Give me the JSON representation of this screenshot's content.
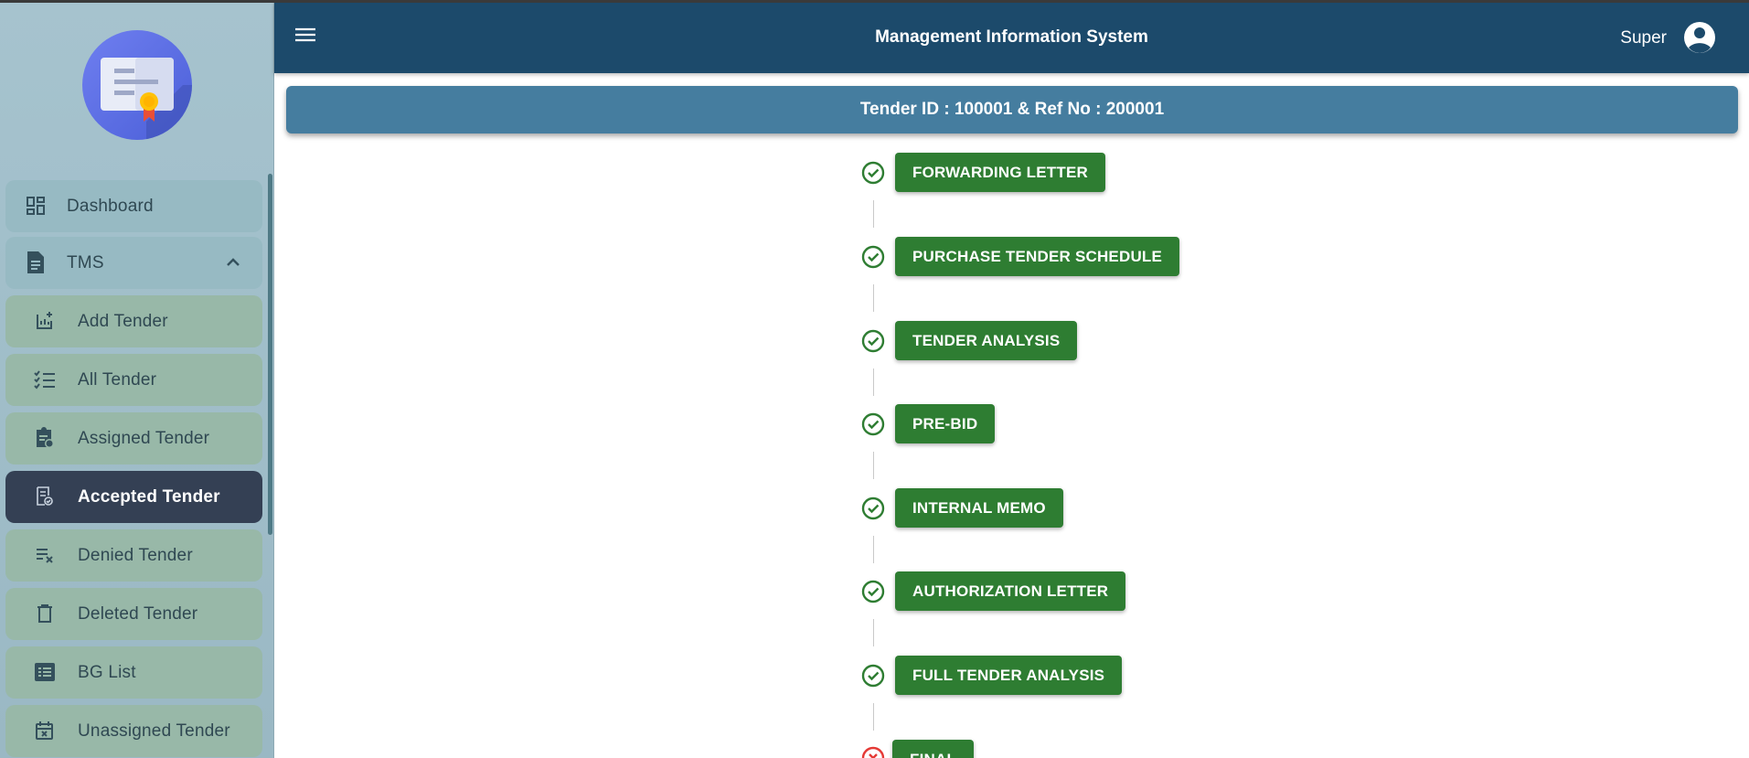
{
  "header": {
    "title": "Management Information System",
    "user_name": "Super"
  },
  "sidebar": {
    "items": [
      {
        "label": "Dashboard",
        "icon": "dashboard-icon"
      },
      {
        "label": "TMS",
        "icon": "document-icon",
        "expanded": true
      },
      {
        "label": "Add Tender",
        "icon": "add-chart-icon"
      },
      {
        "label": "All Tender",
        "icon": "checklist-icon"
      },
      {
        "label": "Assigned Tender",
        "icon": "assigned-clipboard-icon"
      },
      {
        "label": "Accepted Tender",
        "icon": "accepted-document-icon",
        "active": true
      },
      {
        "label": "Denied Tender",
        "icon": "playlist-remove-icon"
      },
      {
        "label": "Deleted Tender",
        "icon": "trash-icon"
      },
      {
        "label": "BG List",
        "icon": "list-box-icon"
      },
      {
        "label": "Unassigned Tender",
        "icon": "calendar-x-icon"
      }
    ]
  },
  "tender": {
    "banner": "Tender ID : 100001 & Ref No : 200001"
  },
  "steps": [
    {
      "label": "FORWARDING LETTER",
      "status": "done"
    },
    {
      "label": "PURCHASE TENDER SCHEDULE",
      "status": "done"
    },
    {
      "label": "TENDER ANALYSIS",
      "status": "done"
    },
    {
      "label": "PRE-BID",
      "status": "done"
    },
    {
      "label": "INTERNAL MEMO",
      "status": "done"
    },
    {
      "label": "AUTHORIZATION LETTER",
      "status": "done"
    },
    {
      "label": "FULL TENDER ANALYSIS",
      "status": "done"
    },
    {
      "label": "FINAL",
      "status": "failed"
    }
  ],
  "colors": {
    "header": "#1c4a6b",
    "banner": "#457d9f",
    "step_button": "#2e7d32",
    "check": "#2e7d32",
    "failed": "#e53935",
    "active_nav": "#344054"
  }
}
